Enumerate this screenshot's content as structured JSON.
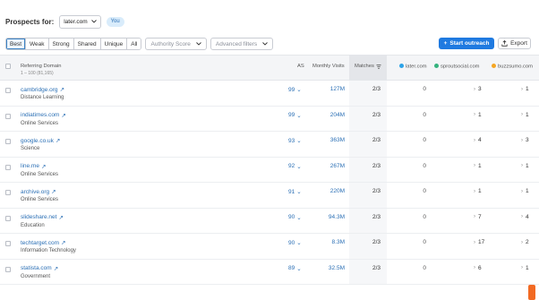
{
  "header": {
    "prospects_label": "Prospects for:",
    "domain_value": "later.com",
    "you_badge": "You"
  },
  "filters": {
    "tabs": [
      "Best",
      "Weak",
      "Strong",
      "Shared",
      "Unique",
      "All"
    ],
    "active_tab": "Best",
    "authority_score": "Authority Score",
    "advanced_filters": "Advanced filters"
  },
  "actions": {
    "start_outreach": "Start outreach",
    "export": "Export"
  },
  "table": {
    "columns": {
      "referring_domain": "Referring Domain",
      "range": "1 – 100 (81,165)",
      "as": "AS",
      "monthly_visits": "Monthly Visits",
      "matches": "Matches",
      "later": "later.com",
      "sprout": "sproutsocial.com",
      "buzz": "buzzsumo.com"
    },
    "column_colors": {
      "later": "#2ca3e8",
      "sprout": "#35b37e",
      "buzz": "#f5a623"
    },
    "rows": [
      {
        "domain": "cambridge.org",
        "category": "Distance Learning",
        "as": "99",
        "visits": "127M",
        "matches": "2/3",
        "later": "0",
        "sprout": "3",
        "buzz": "1"
      },
      {
        "domain": "indiatimes.com",
        "category": "Online Services",
        "as": "99",
        "visits": "204M",
        "matches": "2/3",
        "later": "0",
        "sprout": "1",
        "buzz": "1"
      },
      {
        "domain": "google.co.uk",
        "category": "Science",
        "as": "93",
        "visits": "363M",
        "matches": "2/3",
        "later": "0",
        "sprout": "4",
        "buzz": "3"
      },
      {
        "domain": "line.me",
        "category": "Online Services",
        "as": "92",
        "visits": "267M",
        "matches": "2/3",
        "later": "0",
        "sprout": "1",
        "buzz": "1"
      },
      {
        "domain": "archive.org",
        "category": "Online Services",
        "as": "91",
        "visits": "220M",
        "matches": "2/3",
        "later": "0",
        "sprout": "1",
        "buzz": "1"
      },
      {
        "domain": "slideshare.net",
        "category": "Education",
        "as": "90",
        "visits": "94.3M",
        "matches": "2/3",
        "later": "0",
        "sprout": "7",
        "buzz": "4"
      },
      {
        "domain": "techtarget.com",
        "category": "Information Technology",
        "as": "90",
        "visits": "8.3M",
        "matches": "2/3",
        "later": "0",
        "sprout": "17",
        "buzz": "2"
      },
      {
        "domain": "statista.com",
        "category": "Government",
        "as": "89",
        "visits": "32.5M",
        "matches": "2/3",
        "later": "0",
        "sprout": "6",
        "buzz": "1"
      }
    ]
  }
}
